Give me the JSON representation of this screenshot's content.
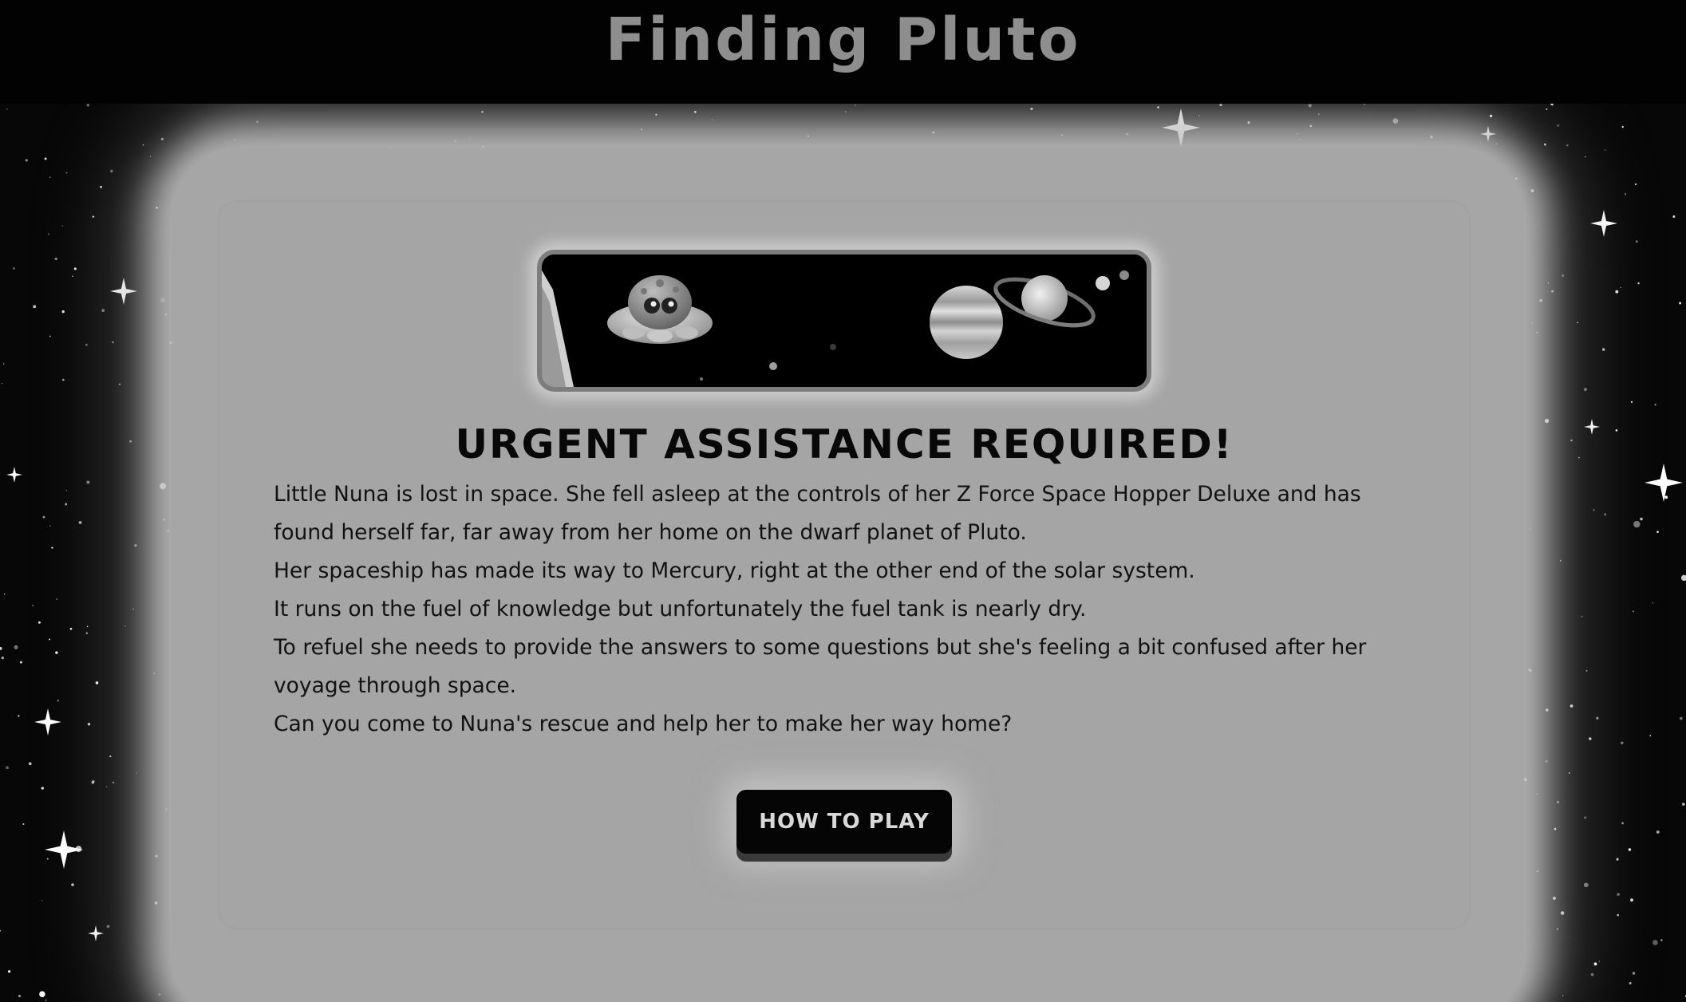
{
  "header": {
    "title": "Finding Pluto"
  },
  "intro": {
    "banner_image": "nuna-spaceship-and-planets-banner",
    "heading": "URGENT ASSISTANCE REQUIRED!",
    "paragraphs": [
      "Little Nuna is lost in space. She fell asleep at the controls of her Z Force Space Hopper Deluxe and has found herself far, far away from her home on the dwarf planet of Pluto.",
      "Her spaceship has made its way to Mercury, right at the other end of the solar system.",
      "It runs on the fuel of knowledge but unfortunately the fuel tank is nearly dry.",
      "To refuel she needs to provide the answers to some questions but she's feeling a bit confused after her voyage through space.",
      "Can you come to Nuna's rescue and help her to make her way home?"
    ],
    "button_label": "HOW TO PLAY"
  },
  "colors": {
    "page_background": "#000000",
    "title": "#8e8e8e",
    "card": "#a5a5a5",
    "button": "#050505",
    "button_text": "#d9d9d9"
  }
}
